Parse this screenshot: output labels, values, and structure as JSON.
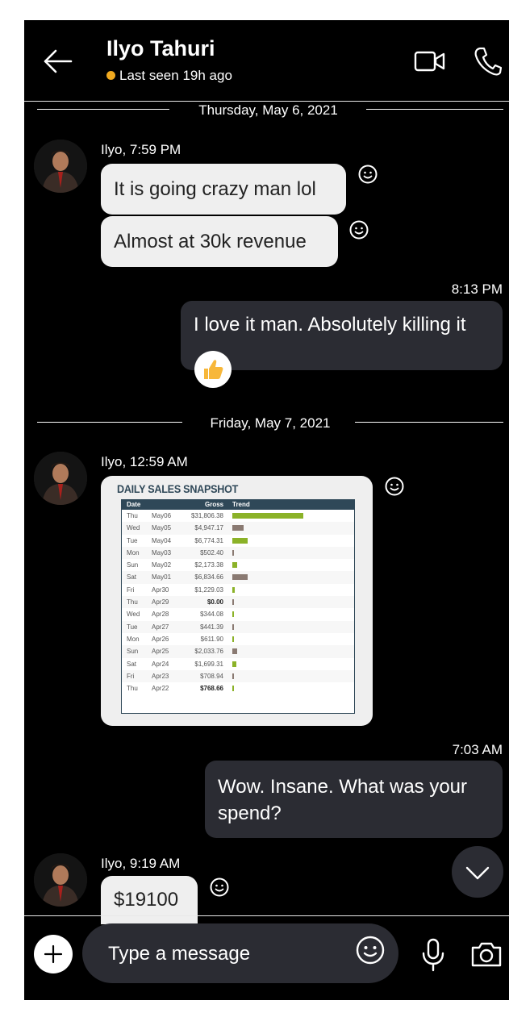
{
  "header": {
    "contact_name": "Ilyo Tahuri",
    "status": "Last seen 19h ago",
    "status_color": "#f0a91f"
  },
  "day1": {
    "date_label": "Thursday, May 6, 2021",
    "incoming": {
      "sender_time": "Ilyo, 7:59 PM",
      "messages": [
        "It is going crazy man lol",
        "Almost at 30k revenue"
      ]
    },
    "outgoing": {
      "time": "8:13 PM",
      "text": "I love it man. Absolutely killing it",
      "reaction": "thumbs-up"
    }
  },
  "day2": {
    "date_label": "Friday, May 7, 2021",
    "incoming_image": {
      "sender_time": "Ilyo, 12:59 AM",
      "snapshot": {
        "title": "DAILY SALES SNAPSHOT",
        "columns": [
          "Date",
          "Gross",
          "Trend"
        ],
        "rows": [
          {
            "day": "Thu",
            "date": "May06",
            "gross": "$31,806.38",
            "value": 31806.38,
            "color": "#8bb228"
          },
          {
            "day": "Wed",
            "date": "May05",
            "gross": "$4,947.17",
            "value": 4947.17,
            "color": "#8a7a72"
          },
          {
            "day": "Tue",
            "date": "May04",
            "gross": "$6,774.31",
            "value": 6774.31,
            "color": "#8bb228"
          },
          {
            "day": "Mon",
            "date": "May03",
            "gross": "$502.40",
            "value": 502.4,
            "color": "#8a7a72"
          },
          {
            "day": "Sun",
            "date": "May02",
            "gross": "$2,173.38",
            "value": 2173.38,
            "color": "#8bb228"
          },
          {
            "day": "Sat",
            "date": "May01",
            "gross": "$6,834.66",
            "value": 6834.66,
            "color": "#8a7a72"
          },
          {
            "day": "Fri",
            "date": "Apr30",
            "gross": "$1,229.03",
            "value": 1229.03,
            "color": "#8bb228"
          },
          {
            "day": "Thu",
            "date": "Apr29",
            "gross": "$0.00",
            "value": 0,
            "color": "#8a7a72"
          },
          {
            "day": "Wed",
            "date": "Apr28",
            "gross": "$344.08",
            "value": 344.08,
            "color": "#8bb228"
          },
          {
            "day": "Tue",
            "date": "Apr27",
            "gross": "$441.39",
            "value": 441.39,
            "color": "#8a7a72"
          },
          {
            "day": "Mon",
            "date": "Apr26",
            "gross": "$611.90",
            "value": 611.9,
            "color": "#8bb228"
          },
          {
            "day": "Sun",
            "date": "Apr25",
            "gross": "$2,033.76",
            "value": 2033.76,
            "color": "#8a7a72"
          },
          {
            "day": "Sat",
            "date": "Apr24",
            "gross": "$1,699.31",
            "value": 1699.31,
            "color": "#8bb228"
          },
          {
            "day": "Fri",
            "date": "Apr23",
            "gross": "$708.94",
            "value": 708.94,
            "color": "#8a7a72"
          },
          {
            "day": "Thu",
            "date": "Apr22",
            "gross": "$768.66",
            "value": 768.66,
            "color": "#8bb228"
          }
        ]
      }
    },
    "outgoing": {
      "time": "7:03 AM",
      "line1": "Wow. Insane. What was your",
      "line2": "spend?"
    },
    "incoming_last": {
      "sender_time": "Ilyo, 9:19 AM",
      "text": "$19100"
    }
  },
  "composer": {
    "placeholder": "Type a message"
  },
  "colors": {
    "background": "#000000",
    "incoming_bubble": "#efefef",
    "outgoing_bubble": "#2b2c33",
    "reaction_bg": "#ffffff",
    "thumb": "#f7b73a"
  }
}
